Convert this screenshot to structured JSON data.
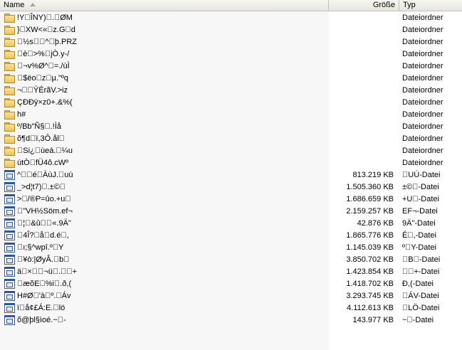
{
  "columns": {
    "name": "Name",
    "size": "Größe",
    "type": "Typ"
  },
  "rows": [
    {
      "name": "!Y\u0000ÎNY)\u0000.\u0000ØM",
      "size": "",
      "type": "Dateiordner",
      "icon": "folder-icon"
    },
    {
      "name": "}\u0000XW<«\u0000z.G\u0000d",
      "size": "",
      "type": "Dateiordner",
      "icon": "folder-icon"
    },
    {
      "name": "\u0000½s\u0000\u0000^\u0000þ.PRZ",
      "size": "",
      "type": "Dateiordner",
      "icon": "folder-icon"
    },
    {
      "name": "\u0000è\u0000>%\u0000jÒ.y-/",
      "size": "",
      "type": "Dateiordner",
      "icon": "folder-icon"
    },
    {
      "name": "\u0000¬v%Ø^\u0000=./ùÌ",
      "size": "",
      "type": "Dateiordner",
      "icon": "folder-icon"
    },
    {
      "name": "\u0000$ëo\u0000z\u0000µ.\"ºq",
      "size": "",
      "type": "Dateiordner",
      "icon": "folder-icon"
    },
    {
      "name": "¬\u0000\u0000ŸÉrãV.>iz",
      "size": "",
      "type": "Dateiordner",
      "icon": "folder-icon"
    },
    {
      "name": "ÇÐÐÿ×z0+.&%(",
      "size": "",
      "type": "Dateiordner",
      "icon": "folder-icon"
    },
    {
      "name": "h#",
      "size": "",
      "type": "Dateiordner",
      "icon": "folder-icon"
    },
    {
      "name": "º/Bb\"Ñ§\u0000.!Ìå",
      "size": "",
      "type": "Dateiordner",
      "icon": "folder-icon"
    },
    {
      "name": "õ¶d\u0000ï,3Ô.ål\u0000",
      "size": "",
      "type": "Dateiordner",
      "icon": "folder-icon"
    },
    {
      "name": "\u0000Si¿\u0000ùeá.\u0000¼u",
      "size": "",
      "type": "Dateiordner",
      "icon": "folder-icon"
    },
    {
      "name": "útÒ\u0000fÜ4ô.cWº",
      "size": "",
      "type": "Dateiordner",
      "icon": "folder-icon"
    },
    {
      "name": "^\u0000\u0000é\u0000ÀùJ.\u0000uù",
      "size": "813.219 KB",
      "type": "\u0000UÙ-Datei",
      "icon": "application-icon"
    },
    {
      "name": "_>d¦t7)\u0000.±©\u0000",
      "size": "1.505.360 KB",
      "type": "±©\u0000-Datei",
      "icon": "application-icon"
    },
    {
      "name": ">\u0000/®P=ûo.+u\u0000",
      "size": "1.686.659 KB",
      "type": "+U\u0000-Datei",
      "icon": "application-icon"
    },
    {
      "name": "\u0000\"VH½Söm.ef¬",
      "size": "2.159.257 KB",
      "type": "EF¬-Datei",
      "icon": "application-icon"
    },
    {
      "name": "\u0000¦\u0000&û\u0000\u0000«.9Ä\"",
      "size": "42.876 KB",
      "type": "9Ä\"-Datei",
      "icon": "application-icon"
    },
    {
      "name": "\u00004Î?\u0000å\u0000d.é\u0000,",
      "size": "1.865.776 KB",
      "type": "É\u0000,-Datei",
      "icon": "application-icon"
    },
    {
      "name": "\u0000ı;§^wpî.º\u0000Y",
      "size": "1.145.039 KB",
      "type": "º\u0000Y-Datei",
      "icon": "application-icon"
    },
    {
      "name": "\u0000¥ò:|ØyÂ.\u0000b\u0000",
      "size": "3.850.702 KB",
      "type": "\u0000B\u0000-Datei",
      "icon": "application-icon"
    },
    {
      "name": "ä\u0000×\u0000\u0000¬ü\u0000.\u0000\u0000+",
      "size": "1.423.854 KB",
      "type": "\u0000\u0000+-Datei",
      "icon": "application-icon"
    },
    {
      "name": "\u0000æõE\u0000%i\u0000.ð,(",
      "size": "1.418.702 KB",
      "type": "Ð,(-Datei",
      "icon": "application-icon"
    },
    {
      "name": "H#Ø\u0000'à\u0000º.\u0000Áv",
      "size": "3.293.745 KB",
      "type": "\u0000ÁV-Datei",
      "icon": "application-icon"
    },
    {
      "name": "ï\u0000å¢£Á:E.\u0000lö",
      "size": "4.112.613 KB",
      "type": "\u0000LÖ-Datei",
      "icon": "application-icon"
    },
    {
      "name": "õ@þl§ìoé.~\u0000-",
      "size": "143.977 KB",
      "type": "~\u0000-Datei",
      "icon": "application-icon"
    }
  ]
}
